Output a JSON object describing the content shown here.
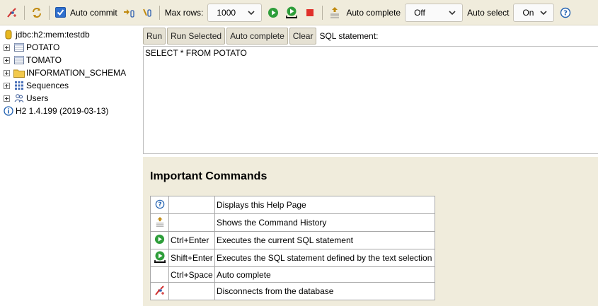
{
  "toolbar": {
    "auto_commit_label": "Auto commit",
    "auto_commit_checked": true,
    "max_rows_label": "Max rows:",
    "max_rows_value": "1000",
    "auto_complete_label": "Auto complete",
    "auto_complete_value": "Off",
    "auto_select_label": "Auto select",
    "auto_select_value": "On"
  },
  "tree": {
    "connection": "jdbc:h2:mem:testdb",
    "items": [
      {
        "label": "POTATO",
        "icon": "table-icon"
      },
      {
        "label": "TOMATO",
        "icon": "table-icon"
      },
      {
        "label": "INFORMATION_SCHEMA",
        "icon": "folder-icon"
      },
      {
        "label": "Sequences",
        "icon": "sequence-icon"
      },
      {
        "label": "Users",
        "icon": "users-icon"
      }
    ],
    "version": "H2 1.4.199 (2019-03-13)"
  },
  "sql": {
    "buttons": {
      "run": "Run",
      "run_selected": "Run Selected",
      "auto_complete": "Auto complete",
      "clear": "Clear"
    },
    "statement_label": "SQL statement:",
    "statement": "SELECT * FROM POTATO"
  },
  "help": {
    "title": "Important Commands",
    "commands": [
      {
        "icon": "help-icon",
        "key": "",
        "description": "Displays this Help Page"
      },
      {
        "icon": "history-icon",
        "key": "",
        "description": "Shows the Command History"
      },
      {
        "icon": "run-icon",
        "key": "Ctrl+Enter",
        "description": "Executes the current SQL statement"
      },
      {
        "icon": "run-selected-icon",
        "key": "Shift+Enter",
        "description": "Executes the SQL statement defined by the text selection"
      },
      {
        "icon": "",
        "key": "Ctrl+Space",
        "description": "Auto complete"
      },
      {
        "icon": "disconnect-icon",
        "key": "",
        "description": "Disconnects from the database"
      }
    ]
  },
  "colors": {
    "toolbar_bg": "#f0ecdc",
    "run_green": "#2e9e3a",
    "stop_red": "#e0302a",
    "help_blue": "#2060b0"
  }
}
